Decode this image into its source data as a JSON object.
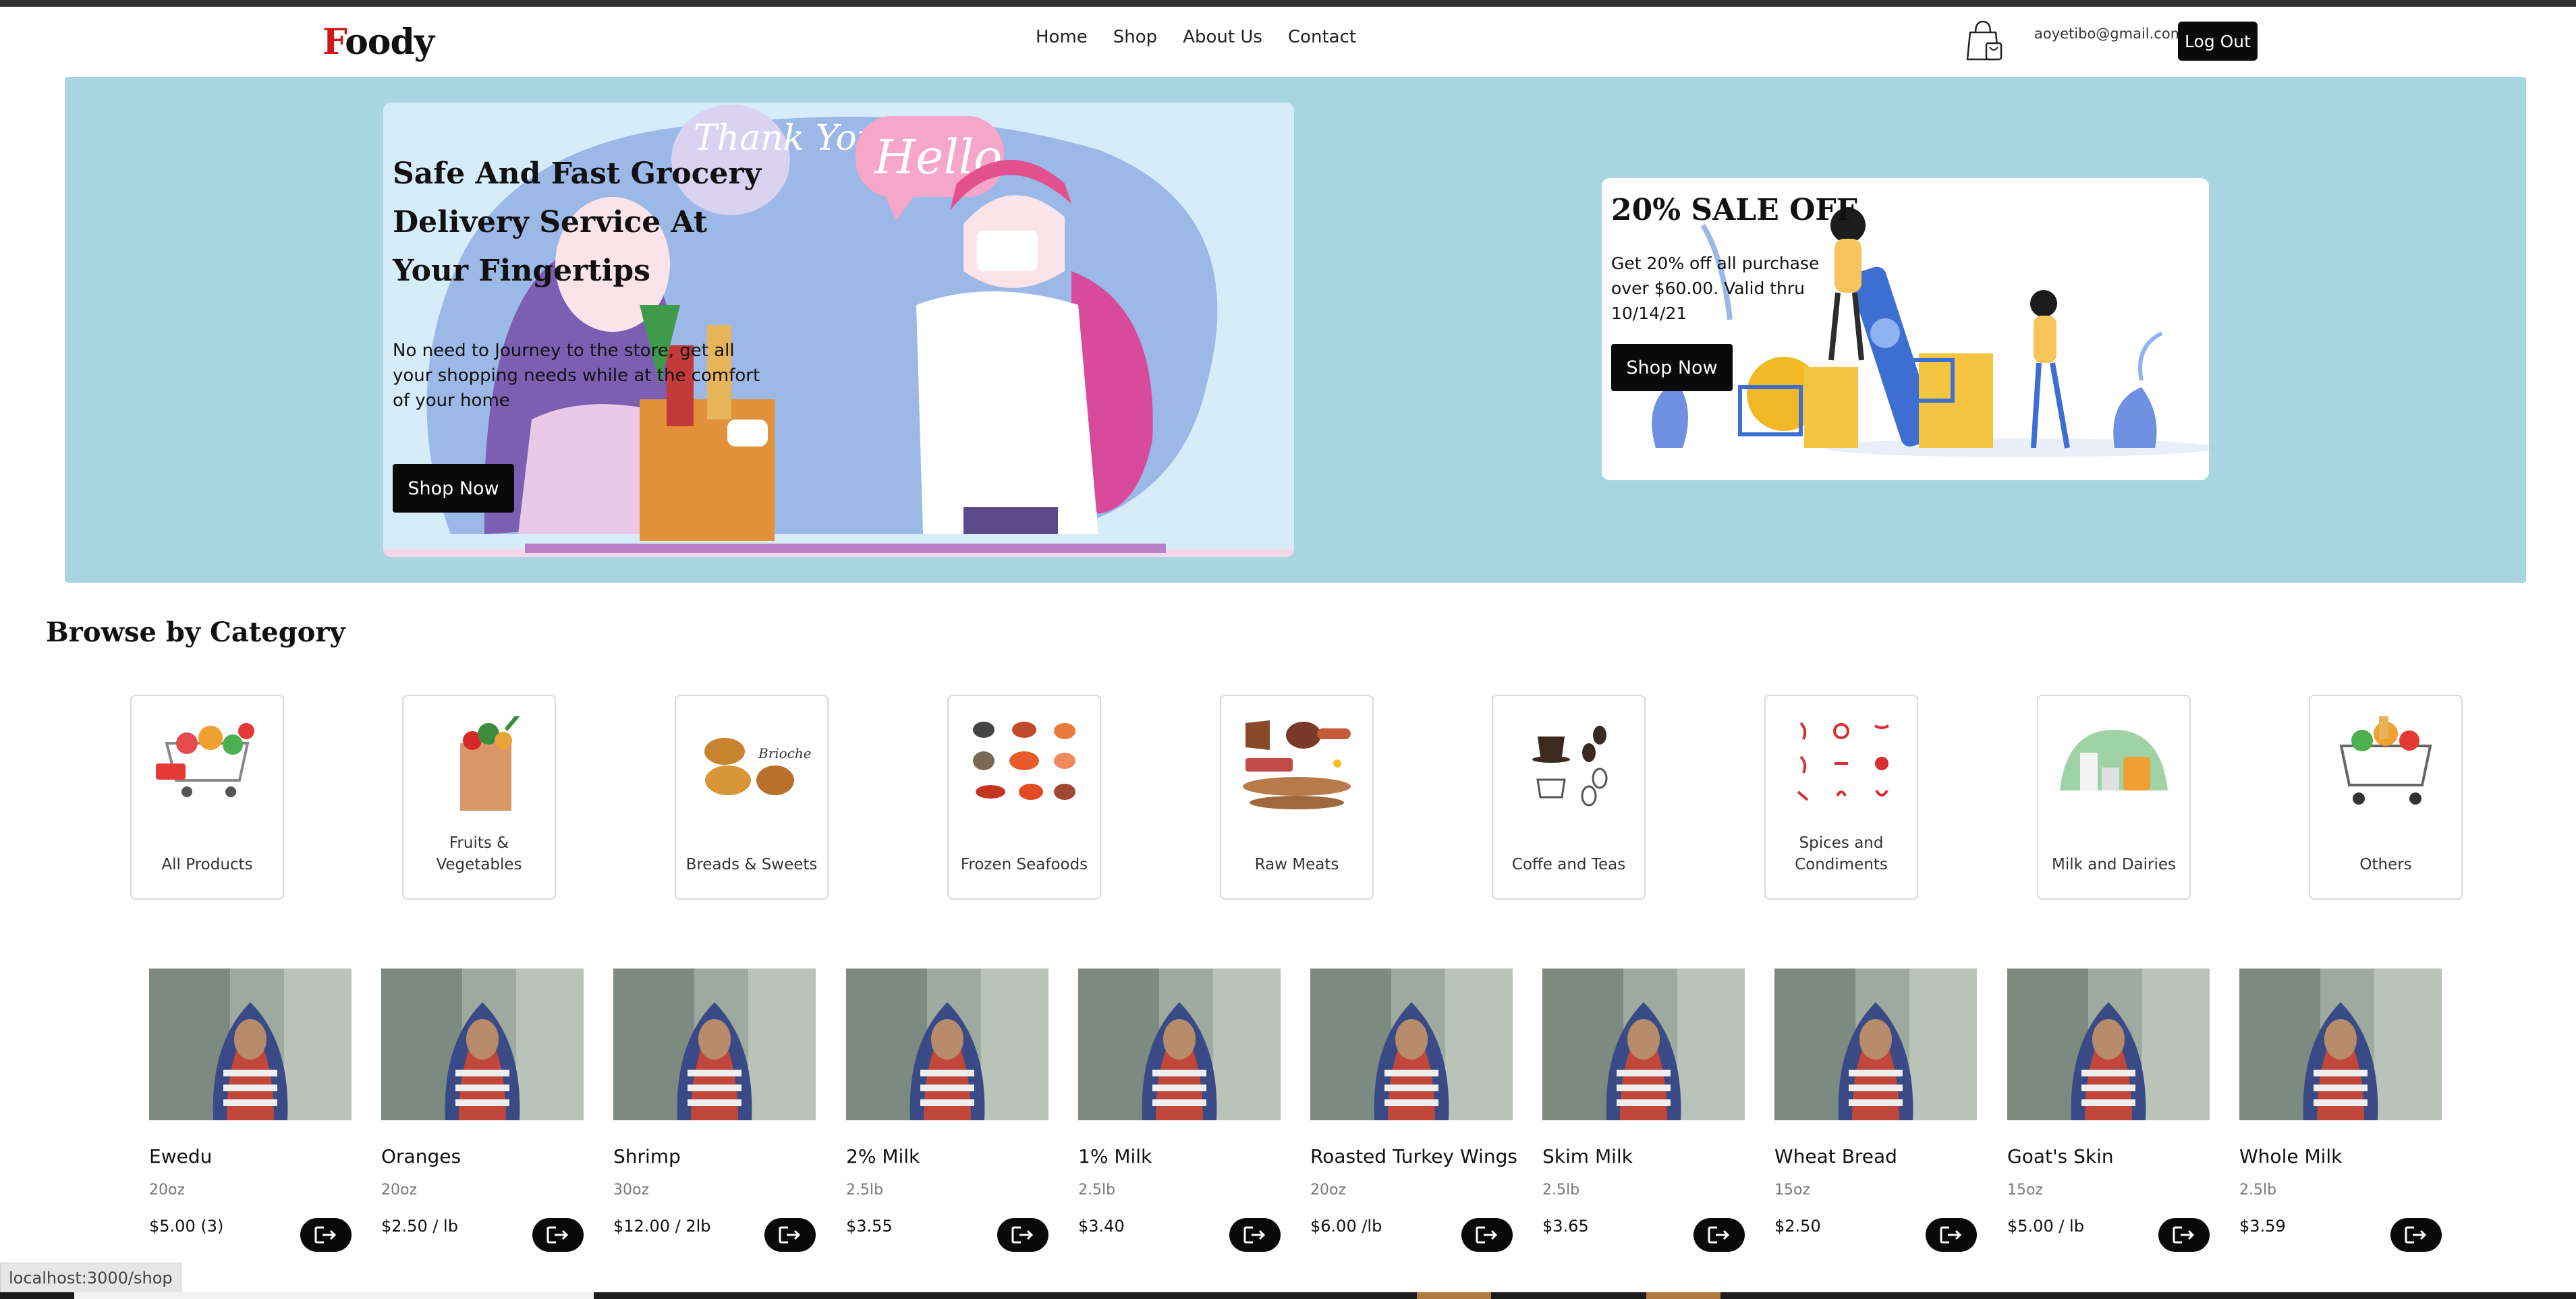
{
  "brand": {
    "first_letter": "F",
    "rest": "oody"
  },
  "nav": {
    "links": [
      "Home",
      "Shop",
      "About Us",
      "Contact"
    ]
  },
  "user": {
    "email": "aoyetibo@gmail.com",
    "logout_label": "Log Out"
  },
  "hero": {
    "title": "Safe And Fast Grocery Delivery Service At Your Fingertips",
    "text": "No need to Journey to the store, get all your shopping needs while at the comfort of your home",
    "button": "Shop Now",
    "illustration_words": [
      "Thank You",
      "Hello"
    ]
  },
  "sale": {
    "title": "20% SALE OFF",
    "text": "Get 20% off all purchase over $60.00. Valid thru 10/14/21",
    "button": "Shop Now"
  },
  "categories": {
    "title": "Browse by Category",
    "items": [
      {
        "label": "All Products",
        "icon": "shopping-cart-icon"
      },
      {
        "label": "Fruits & Vegetables",
        "icon": "grocery-bag-icon"
      },
      {
        "label": "Breads & Sweets",
        "icon": "bread-icon",
        "image_text": "Brioche"
      },
      {
        "label": "Frozen Seafoods",
        "icon": "seafood-icon"
      },
      {
        "label": "Raw Meats",
        "icon": "meat-icon"
      },
      {
        "label": "Coffe and Teas",
        "icon": "coffee-icon"
      },
      {
        "label": "Spices and Condiments",
        "icon": "spices-icon"
      },
      {
        "label": "Milk and Dairies",
        "icon": "dairy-icon"
      },
      {
        "label": "Others",
        "icon": "basket-cart-icon"
      }
    ]
  },
  "products": [
    {
      "name": "Ewedu",
      "size": "20oz",
      "price": "$5.00 (3)"
    },
    {
      "name": "Oranges",
      "size": "20oz",
      "price": "$2.50 / lb"
    },
    {
      "name": "Shrimp",
      "size": "30oz",
      "price": "$12.00 / 2lb"
    },
    {
      "name": "2% Milk",
      "size": "2.5lb",
      "price": "$3.55"
    },
    {
      "name": "1% Milk",
      "size": "2.5lb",
      "price": "$3.40"
    },
    {
      "name": "Roasted Turkey Wings",
      "size": "20oz",
      "price": "$6.00 /lb"
    },
    {
      "name": "Skim Milk",
      "size": "2.5lb",
      "price": "$3.65"
    },
    {
      "name": "Wheat Bread",
      "size": "15oz",
      "price": "$2.50"
    },
    {
      "name": "Goat's Skin",
      "size": "15oz",
      "price": "$5.00 / lb"
    },
    {
      "name": "Whole Milk",
      "size": "2.5lb",
      "price": "$3.59"
    }
  ],
  "product_action_icon": "add-to-cart-icon",
  "status": {
    "url": "localhost:3000/shop"
  },
  "colors": {
    "hero_bg": "#a9d5e3",
    "button": "#0a0a0a",
    "logo_red": "#d0161b"
  }
}
